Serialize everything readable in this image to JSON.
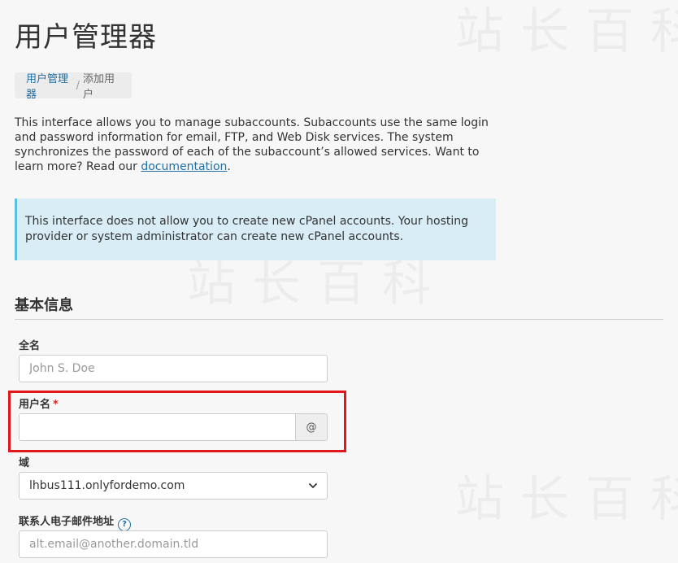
{
  "page_title": "用户管理器",
  "breadcrumb": {
    "parent": "用户管理器",
    "separator": "/",
    "current": "添加用户"
  },
  "intro": {
    "text": "This interface allows you to manage subaccounts. Subaccounts use the same login and password information for email, FTP, and Web Disk services. The system synchronizes the password of each of the subaccount’s allowed services. Want to learn more? Read our ",
    "link_text": "documentation",
    "suffix": "."
  },
  "alert": {
    "text": "This interface does not allow you to create new cPanel accounts. Your hosting provider or system administrator can create new cPanel accounts."
  },
  "section": {
    "title": "基本信息"
  },
  "form": {
    "full_name": {
      "label": "全名",
      "placeholder": "John S. Doe",
      "value": ""
    },
    "username": {
      "label": "用户名",
      "required_mark": "*",
      "value": "",
      "addon": "@"
    },
    "domain": {
      "label": "域",
      "selected": "lhbus111.onlyfordemo.com"
    },
    "contact_email": {
      "label": "联系人电子邮件地址",
      "help": "?",
      "placeholder": "alt.email@another.domain.tld",
      "value": ""
    }
  },
  "icons": {
    "select_arrow": "chevron-down-icon",
    "help": "question-circle-icon"
  },
  "colors": {
    "link": "#1f6fa5",
    "alert_bg": "#d9edf7",
    "alert_border": "#5bc0de",
    "highlight": "#e0171b",
    "required": "#c9302c"
  },
  "watermark": "站长百科"
}
